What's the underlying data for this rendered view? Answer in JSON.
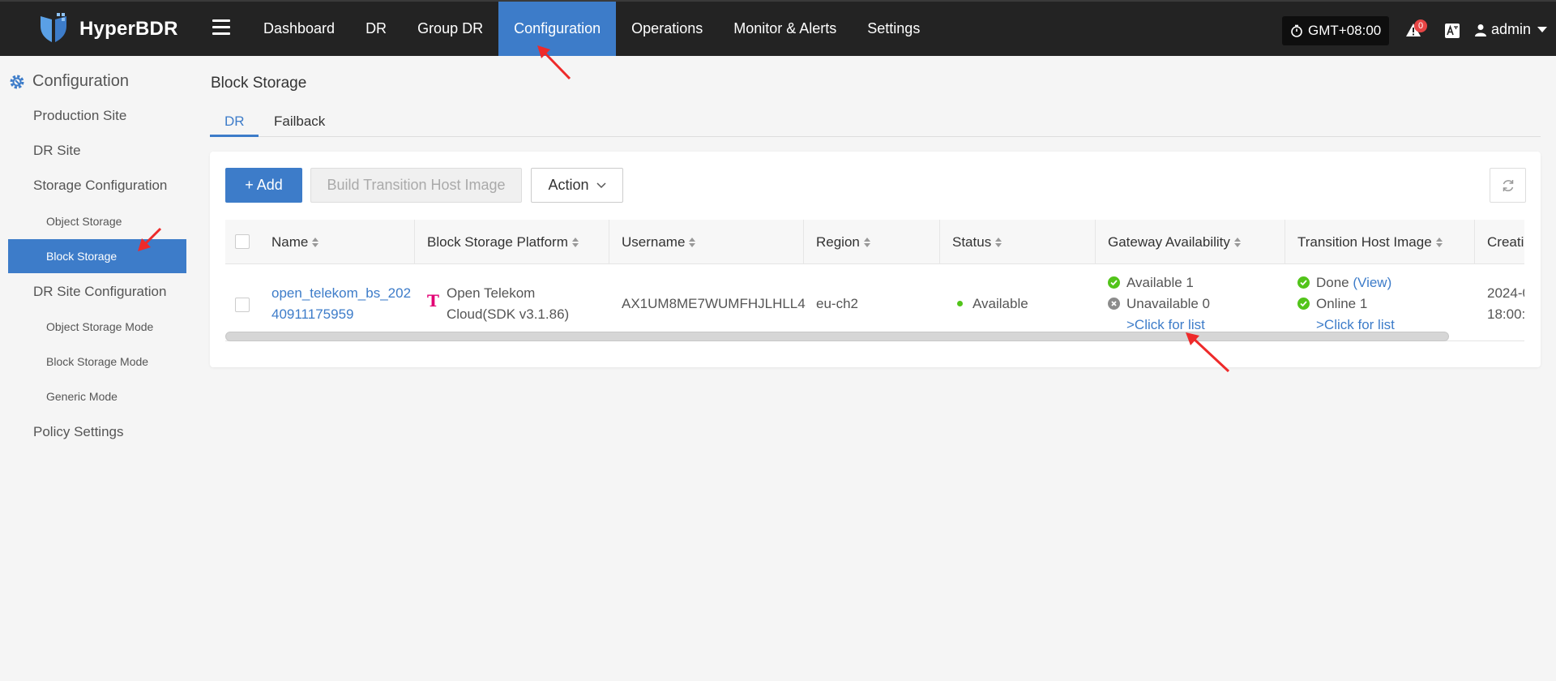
{
  "app": {
    "name": "HyperBDR"
  },
  "nav": {
    "items": [
      {
        "label": "Dashboard",
        "active": false
      },
      {
        "label": "DR",
        "active": false
      },
      {
        "label": "Group DR",
        "active": false
      },
      {
        "label": "Configuration",
        "active": true
      },
      {
        "label": "Operations",
        "active": false
      },
      {
        "label": "Monitor & Alerts",
        "active": false
      },
      {
        "label": "Settings",
        "active": false
      }
    ],
    "timezone": "GMT+08:00",
    "alert_count": "0",
    "user": "admin"
  },
  "sidebar": {
    "title": "Configuration",
    "production_site": "Production Site",
    "dr_site": "DR Site",
    "storage_configuration": "Storage Configuration",
    "object_storage": "Object Storage",
    "block_storage": "Block Storage",
    "dr_site_configuration": "DR Site Configuration",
    "object_storage_mode": "Object Storage Mode",
    "block_storage_mode": "Block Storage Mode",
    "generic_mode": "Generic Mode",
    "policy_settings": "Policy Settings"
  },
  "page": {
    "title": "Block Storage",
    "tabs": [
      {
        "label": "DR",
        "active": true
      },
      {
        "label": "Failback",
        "active": false
      }
    ]
  },
  "toolbar": {
    "add": "+ Add",
    "build": "Build Transition Host Image",
    "action": "Action"
  },
  "table": {
    "columns": {
      "name": "Name",
      "platform": "Block Storage Platform",
      "username": "Username",
      "region": "Region",
      "status": "Status",
      "gateway": "Gateway Availability",
      "transition": "Transition Host Image",
      "creation": "Creati"
    },
    "rows": [
      {
        "name_line1": "open_telekom_bs_202",
        "name_line2": "40911175959",
        "platform_line1": "Open Telekom",
        "platform_line2": "Cloud(SDK v3.1.86)",
        "platform_logo": "T",
        "username": "AX1UM8ME7WUMFHJLHLL4",
        "region": "eu-ch2",
        "status": "Available",
        "gateway_available": "Available 1",
        "gateway_unavailable": "Unavailable 0",
        "gateway_list_link": ">Click for list",
        "transition_done": "Done",
        "transition_view": "(View)",
        "transition_online": "Online 1",
        "transition_list_link": ">Click for list",
        "creation_line1": "2024-0",
        "creation_line2": "18:00:"
      }
    ]
  },
  "colors": {
    "accent": "#3d7cc9",
    "topbar": "#232323",
    "success": "#52c41a",
    "annotation_arrow": "#ee2a2a",
    "telekom_magenta": "#e20074"
  }
}
